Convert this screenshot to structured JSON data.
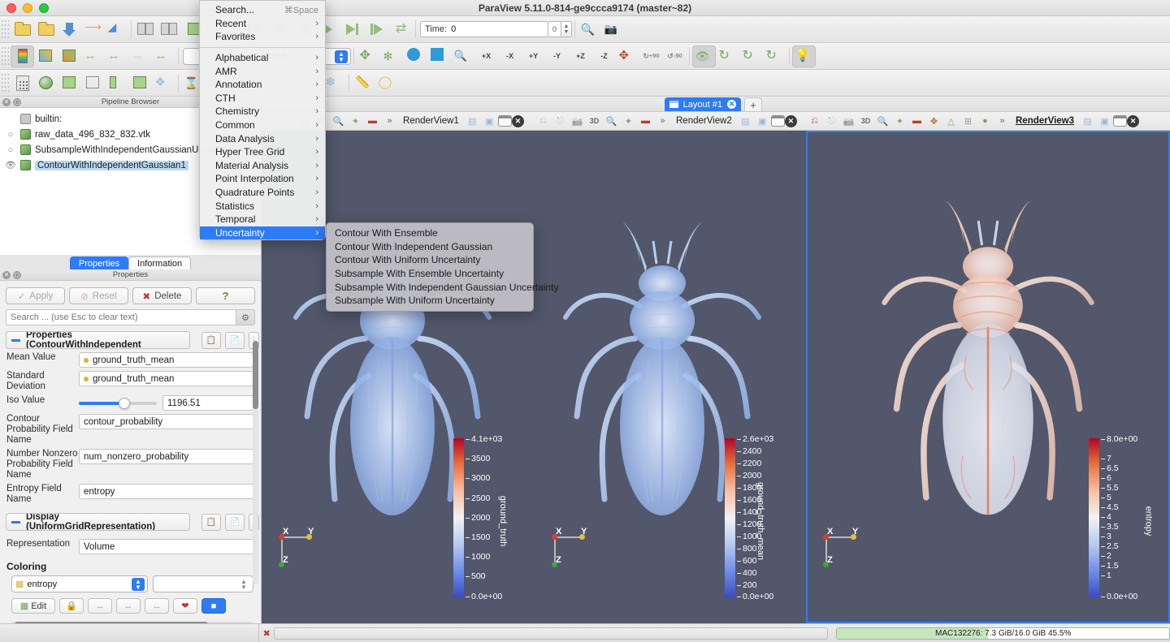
{
  "window": {
    "title": "ParaView 5.11.0-814-ge9ccca9174 (master~82)"
  },
  "toolbar": {
    "time_label": "Time:",
    "time_value": "0",
    "time_index": "0",
    "representation_value": "Volume",
    "rotate_plus_label": "+90",
    "rotate_minus_label": "-90",
    "axis_buttons": [
      "+X",
      "-X",
      "+Y",
      "-Y",
      "+Z",
      "-Z"
    ]
  },
  "menu": {
    "items": [
      {
        "label": "Search...",
        "accel": "⌘Space",
        "submenu": false
      },
      {
        "label": "Recent",
        "submenu": true
      },
      {
        "label": "Favorites",
        "submenu": true
      },
      {
        "separator": true
      },
      {
        "label": "Alphabetical",
        "submenu": true
      },
      {
        "label": "AMR",
        "submenu": true
      },
      {
        "label": "Annotation",
        "submenu": true
      },
      {
        "label": "CTH",
        "submenu": true
      },
      {
        "label": "Chemistry",
        "submenu": true
      },
      {
        "label": "Common",
        "submenu": true
      },
      {
        "label": "Data Analysis",
        "submenu": true
      },
      {
        "label": "Hyper Tree Grid",
        "submenu": true
      },
      {
        "label": "Material Analysis",
        "submenu": true
      },
      {
        "label": "Point Interpolation",
        "submenu": true
      },
      {
        "label": "Quadrature Points",
        "submenu": true
      },
      {
        "label": "Statistics",
        "submenu": true
      },
      {
        "label": "Temporal",
        "submenu": true
      },
      {
        "label": "Uncertainty",
        "submenu": true,
        "selected": true
      }
    ],
    "submenu_items": [
      "Contour With Ensemble",
      "Contour With Independent Gaussian",
      "Contour With Uniform Uncertainty",
      "Subsample With Ensemble Uncertainty",
      "Subsample With Independent Gaussian Uncertainty",
      "Subsample With Uniform Uncertainty"
    ]
  },
  "pipeline": {
    "title": "Pipeline Browser",
    "items": [
      {
        "label": "builtin:",
        "type": "builtin",
        "eye": false,
        "active": false
      },
      {
        "label": "raw_data_496_832_832.vtk",
        "type": "source",
        "eye": "hidden",
        "active": false
      },
      {
        "label": "SubsampleWithIndependentGaussianUncertai",
        "type": "source",
        "eye": "hidden",
        "active": false
      },
      {
        "label": "ContourWithIndependentGaussian1",
        "type": "source",
        "eye": "visible",
        "active": true
      }
    ]
  },
  "tabs": {
    "properties": "Properties",
    "information": "Information"
  },
  "properties": {
    "title": "Properties",
    "apply_label": "Apply",
    "reset_label": "Reset",
    "delete_label": "Delete",
    "help_label": "?",
    "search_placeholder": "Search ... (use Esc to clear text)",
    "search_value": "",
    "section_title": "Properties (ContourWithIndependent",
    "fields": [
      {
        "label": "Mean Value",
        "value": "ground_truth_mean",
        "kind": "array"
      },
      {
        "label": "Standard Deviation",
        "value": "ground_truth_mean",
        "kind": "array"
      },
      {
        "label": "Iso Value",
        "value": "1196.51",
        "kind": "slider"
      },
      {
        "label": "Contour Probability Field Name",
        "value": "contour_probability",
        "kind": "text"
      },
      {
        "label": "Number Nonzero Probability Field Name",
        "value": "num_nonzero_probability",
        "kind": "text"
      },
      {
        "label": "Entropy Field Name",
        "value": "entropy",
        "kind": "text"
      }
    ],
    "display_section_title": "Display (UniformGridRepresentation)",
    "representation_label": "Representation",
    "representation_value": "Volume",
    "coloring_label": "Coloring",
    "coloring_array": "entropy",
    "color_buttons": [
      {
        "label": "Edit",
        "icon": "edit-color-map-icon"
      },
      {
        "label": "",
        "icon": "choose-preset-icon"
      },
      {
        "label": "",
        "icon": "rescale-to-data-range-icon"
      },
      {
        "label": "",
        "icon": "rescale-custom-range-icon"
      },
      {
        "label": "",
        "icon": "rescale-over-time-icon"
      },
      {
        "label": "",
        "icon": "rescale-visible-range-icon"
      },
      {
        "label": "",
        "icon": "toggle-color-legend-icon"
      }
    ]
  },
  "layout": {
    "tab_label": "Layout #1",
    "add_label": "+"
  },
  "views": [
    {
      "name": "RenderView1",
      "active": false,
      "beetle_color": "blue",
      "legend": {
        "title": "ground_truth",
        "max_label": "4.1e+03",
        "min_label": "0.0e+00",
        "ticks": [
          "4.1e+03",
          "3500",
          "3000",
          "2500",
          "2000",
          "1500",
          "1000",
          "500",
          "0.0e+00"
        ],
        "range": [
          0,
          4100
        ]
      }
    },
    {
      "name": "RenderView2",
      "active": false,
      "beetle_color": "blue",
      "legend": {
        "title": "ground_truth_mean",
        "max_label": "2.6e+03",
        "min_label": "0.0e+00",
        "ticks": [
          "2.6e+03",
          "2400",
          "2200",
          "2000",
          "1800",
          "1600",
          "1400",
          "1200",
          "1000",
          "800",
          "600",
          "400",
          "200",
          "0.0e+00"
        ],
        "range": [
          0,
          2600
        ]
      }
    },
    {
      "name": "RenderView3",
      "active": true,
      "beetle_color": "red",
      "legend": {
        "title": "entropy",
        "max_label": "8.0e+00",
        "min_label": "0.0e+00",
        "ticks": [
          "8.0e+00",
          "7",
          "6.5",
          "6",
          "5.5",
          "5",
          "4.5",
          "4",
          "3.5",
          "3",
          "2.5",
          "2",
          "1.5",
          "1",
          "0.0e+00"
        ],
        "range": [
          0,
          8
        ]
      }
    }
  ],
  "axes": {
    "x": "X",
    "y": "Y",
    "z": "Z"
  },
  "status": {
    "memory_text": "MAC132276: 7.3 GiB/16.0 GiB 45.5%",
    "memory_percent": 45.5
  },
  "colors": {
    "accent": "#2f7bf6",
    "viewport_bg": "#52576b",
    "status_green": "#c6e6c0"
  }
}
